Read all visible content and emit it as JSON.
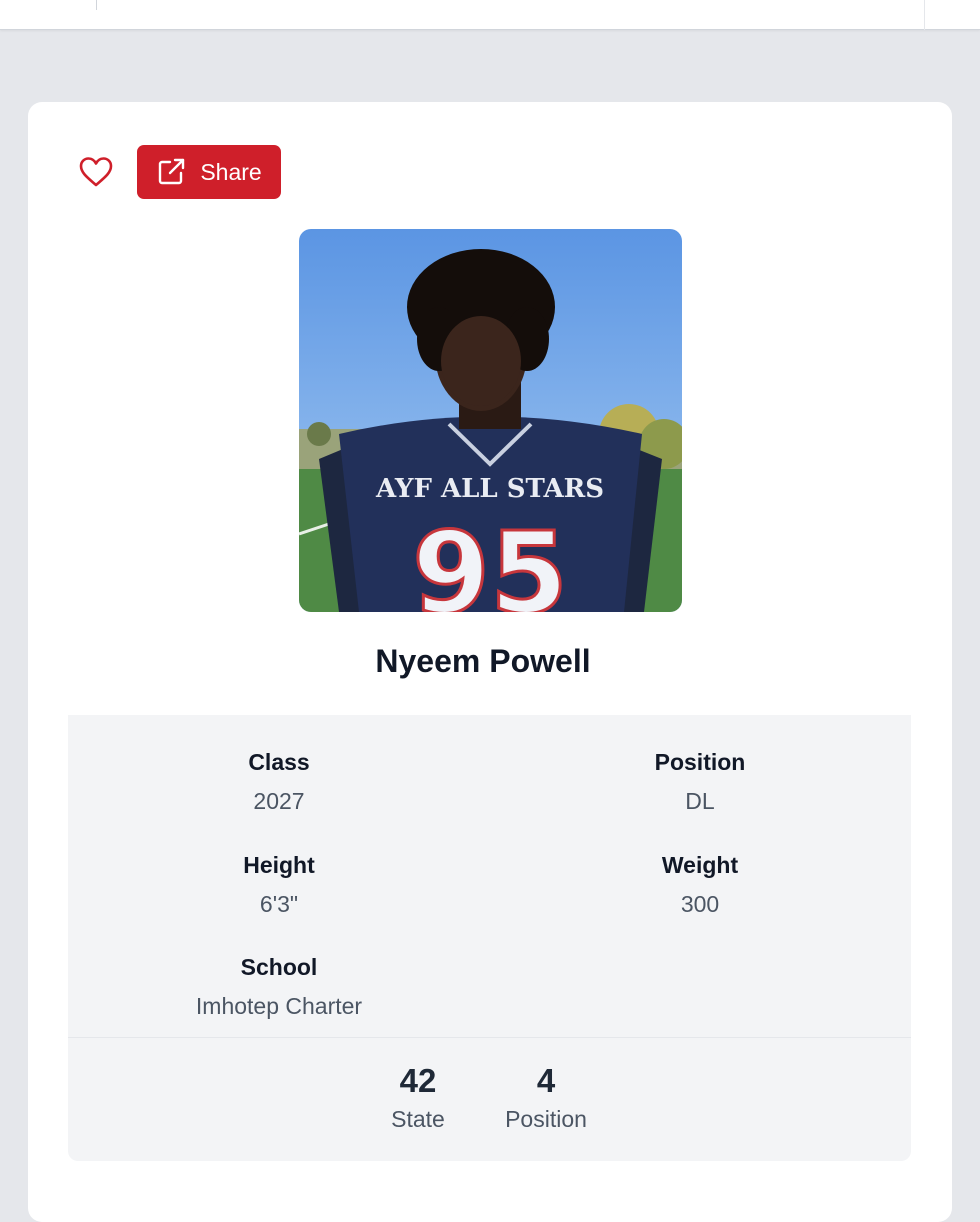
{
  "header": {},
  "actions": {
    "favorite_icon": "heart-outline-icon",
    "share_label": "Share",
    "share_icon": "external-link-icon",
    "accent_color": "#cf1f2a"
  },
  "player": {
    "name": "Nyeem Powell",
    "photo": {
      "jersey_text": "AYF ALL STARS",
      "jersey_number": "95"
    }
  },
  "details": [
    {
      "label": "Class",
      "value": "2027"
    },
    {
      "label": "Position",
      "value": "DL"
    },
    {
      "label": "Height",
      "value": "6'3\""
    },
    {
      "label": "Weight",
      "value": "300"
    },
    {
      "label": "School",
      "value": "Imhotep Charter"
    }
  ],
  "rankings": [
    {
      "value": "42",
      "label": "State"
    },
    {
      "value": "4",
      "label": "Position"
    }
  ]
}
